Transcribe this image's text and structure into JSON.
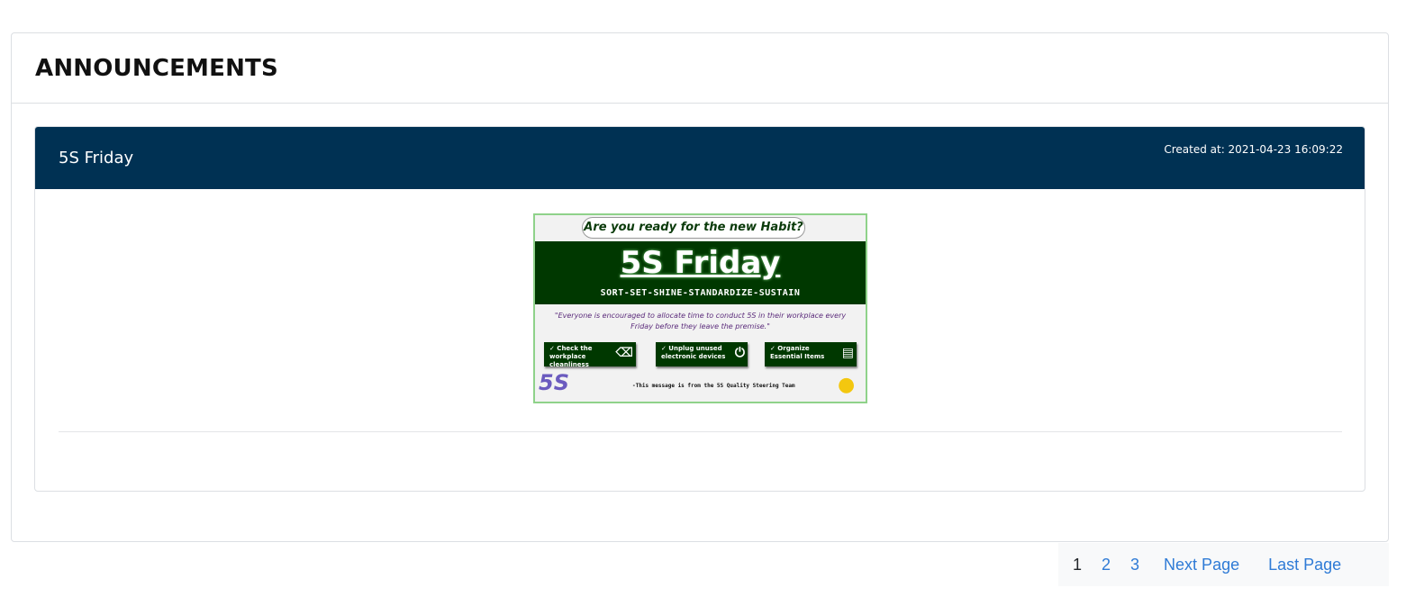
{
  "page": {
    "heading": "ANNOUNCEMENTS"
  },
  "announcement": {
    "title": "5S Friday",
    "created": "Created at: 2021-04-23 16:09:22",
    "flyer": {
      "tagline": "Are you ready for the new Habit?",
      "title": "5S Friday",
      "subtitle": "SORT-SET-SHINE-STANDARDIZE-SUSTAIN",
      "quote": "\"Everyone is encouraged to allocate time to conduct 5S in their workplace every Friday before they leave the premise.\"",
      "items": [
        {
          "text": "✓ Check the workplace cleanliness",
          "icon": "broom-icon"
        },
        {
          "text": "✓ Unplug unused electronic devices",
          "icon": "power-icon"
        },
        {
          "text": "✓ Organize Essential Items",
          "icon": "document-icon"
        }
      ],
      "logo": "5S",
      "footer": "-This message is from the 5S Quality Steering Team"
    }
  },
  "pagination": {
    "pages": [
      "1",
      "2",
      "3"
    ],
    "next": "Next Page",
    "last": "Last Page",
    "current": "1"
  },
  "colors": {
    "header_bg": "#003153",
    "link": "#2f7bd6",
    "flyer_green": "#003800"
  }
}
